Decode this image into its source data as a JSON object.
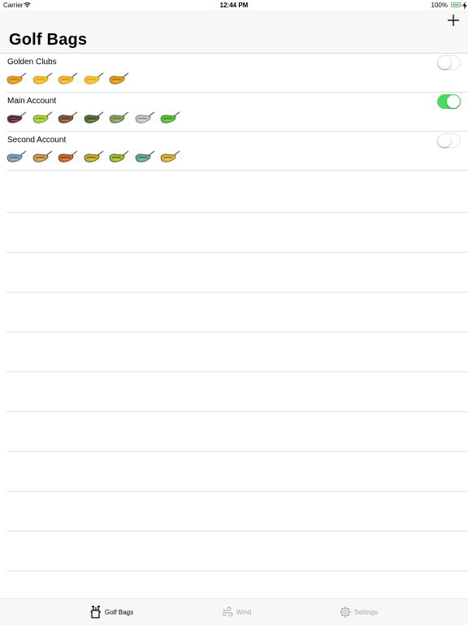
{
  "status_bar": {
    "carrier": "Carrier",
    "time": "12:44 PM",
    "battery_percent": "100%",
    "battery_level": 1.0,
    "wifi_icon": "wifi-icon",
    "charging_icon": "charging-bolt-icon"
  },
  "nav": {
    "title": "Golf Bags",
    "add_icon": "plus-icon"
  },
  "accent_color": "#4cd964",
  "bags": [
    {
      "name": "Golden Clubs",
      "enabled": false,
      "clubs": [
        {
          "icon": "club-head-icon",
          "color": "#e8a317",
          "accent": "#b35c00"
        },
        {
          "icon": "club-head-icon",
          "color": "#f2c32b",
          "accent": "#c98b00"
        },
        {
          "icon": "club-head-icon",
          "color": "#f0b93a",
          "accent": "#cc7a00"
        },
        {
          "icon": "club-head-icon",
          "color": "#f4c233",
          "accent": "#d99000"
        },
        {
          "icon": "club-head-icon",
          "color": "#e0a020",
          "accent": "#8a5200"
        }
      ]
    },
    {
      "name": "Main Account",
      "enabled": true,
      "clubs": [
        {
          "icon": "club-head-icon",
          "color": "#3a3a3a",
          "accent": "#d23030"
        },
        {
          "icon": "club-head-icon",
          "color": "#a6d63a",
          "accent": "#4f7a12"
        },
        {
          "icon": "club-head-icon",
          "color": "#8a5a3a",
          "accent": "#3c2a1a"
        },
        {
          "icon": "club-head-icon",
          "color": "#5a6e3a",
          "accent": "#2c3a1a"
        },
        {
          "icon": "club-head-icon",
          "color": "#8aa060",
          "accent": "#4a5a30"
        },
        {
          "icon": "club-head-icon",
          "color": "#c8c8c8",
          "accent": "#6a6a6a"
        },
        {
          "icon": "club-head-icon",
          "color": "#5cc23a",
          "accent": "#2a6a1a"
        }
      ]
    },
    {
      "name": "Second Account",
      "enabled": false,
      "clubs": [
        {
          "icon": "club-head-icon",
          "color": "#8aa0b8",
          "accent": "#3a4a5a"
        },
        {
          "icon": "club-head-icon",
          "color": "#d0a050",
          "accent": "#4a3a2a"
        },
        {
          "icon": "club-head-icon",
          "color": "#c86a30",
          "accent": "#5a2a10"
        },
        {
          "icon": "club-head-icon",
          "color": "#c8b030",
          "accent": "#3a3a1a"
        },
        {
          "icon": "club-head-icon",
          "color": "#a8c030",
          "accent": "#2a3a1a"
        },
        {
          "icon": "club-head-icon",
          "color": "#6aa8a0",
          "accent": "#2a4a4a"
        },
        {
          "icon": "club-head-icon",
          "color": "#d8b840",
          "accent": "#5a4a1a"
        }
      ]
    }
  ],
  "tabs": [
    {
      "label": "Golf Bags",
      "icon": "golf-bag-icon",
      "active": true
    },
    {
      "label": "Wind",
      "icon": "wind-icon",
      "active": false
    },
    {
      "label": "Settings",
      "icon": "gear-icon",
      "active": false
    }
  ]
}
